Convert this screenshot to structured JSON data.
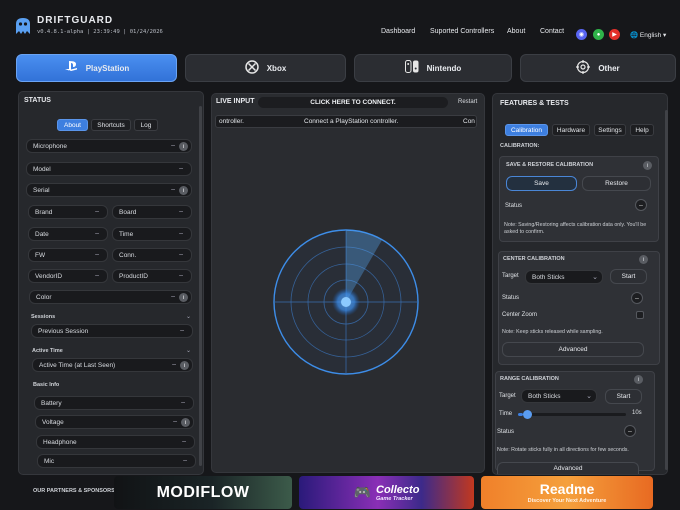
{
  "header": {
    "brand": "DRIFTGUARD",
    "version": "v0.4.8.1-alpha | 23:39:49 | 01/24/2026",
    "nav": [
      "Dashboard",
      "Suported Controllers",
      "About",
      "Contact"
    ],
    "language": "English",
    "language_caret": "▾"
  },
  "consoles": [
    {
      "label": "PlayStation",
      "icon": "playstation-icon"
    },
    {
      "label": "Xbox",
      "icon": "xbox-icon"
    },
    {
      "label": "Nintendo",
      "icon": "nintendo-switch-icon"
    },
    {
      "label": "Other",
      "icon": "target-icon"
    }
  ],
  "status": {
    "title": "STATUS",
    "tabs": [
      "About",
      "Shortcuts",
      "Log"
    ],
    "fields": {
      "microphone": "Microphone",
      "model": "Model",
      "serial": "Serial",
      "brand": "Brand",
      "board": "Board",
      "date": "Date",
      "time": "Time",
      "fw": "FW",
      "conn": "Conn.",
      "vendorid": "VendorID",
      "productid": "ProductID",
      "color": "Color",
      "previous_session": "Previous Session",
      "active_time_field": "Active Time (at Last Seen)",
      "battery": "Battery",
      "voltage": "Voltage",
      "headphone": "Headphone",
      "mic": "Mic"
    },
    "sections": {
      "sessions": "Sessions",
      "active_time": "Active Time",
      "basic_info": "Basic Info"
    },
    "dash": "–",
    "info": "i"
  },
  "live_input": {
    "title": "LIVE INPUT",
    "connect": "CLICK HERE TO CONNECT.",
    "restart": "Restart",
    "ticker_left": "ontroller.",
    "ticker_center": "Connect a PlayStation controller.",
    "ticker_right": "Con"
  },
  "features": {
    "title": "FEATURES & TESTS",
    "tabs": [
      "Calibration",
      "Hardware",
      "Settings",
      "Help"
    ],
    "calibration_label": "CALIBRATION:",
    "save_restore": {
      "title": "SAVE & RESTORE CALIBRATION",
      "save": "Save",
      "restore": "Restore",
      "status": "Status",
      "note": "Note: Saving/Restoring affects calibration data only. You'll be asked to confirm."
    },
    "center": {
      "title": "CENTER CALIBRATION",
      "target_label": "Target",
      "target_value": "Both Sticks",
      "start": "Start",
      "status": "Status",
      "zoom": "Center Zoom",
      "note": "Note: Keep sticks released while sampling.",
      "advanced": "Advanced"
    },
    "range": {
      "title": "RANGE CALIBRATION",
      "target_label": "Target",
      "target_value": "Both Sticks",
      "start": "Start",
      "time_label": "Time",
      "time_value": "10s",
      "time_fraction": 0.05,
      "status": "Status",
      "note": "Note: Rotate sticks fully in all directions for few seconds.",
      "advanced": "Advanced"
    }
  },
  "partners": {
    "label": "OUR PARTNERS & SPONSORS:",
    "sponsors": [
      {
        "name": "MODIFLOW",
        "sub": ""
      },
      {
        "name": "Collecto",
        "sub": "Game Tracker"
      },
      {
        "name": "Readme",
        "sub": "Discover Your Next Adventure"
      }
    ]
  },
  "colors": {
    "accent": "#3d7fe0",
    "radar": "#4a9cf0",
    "background": "#16171a",
    "panel": "#26282c"
  }
}
